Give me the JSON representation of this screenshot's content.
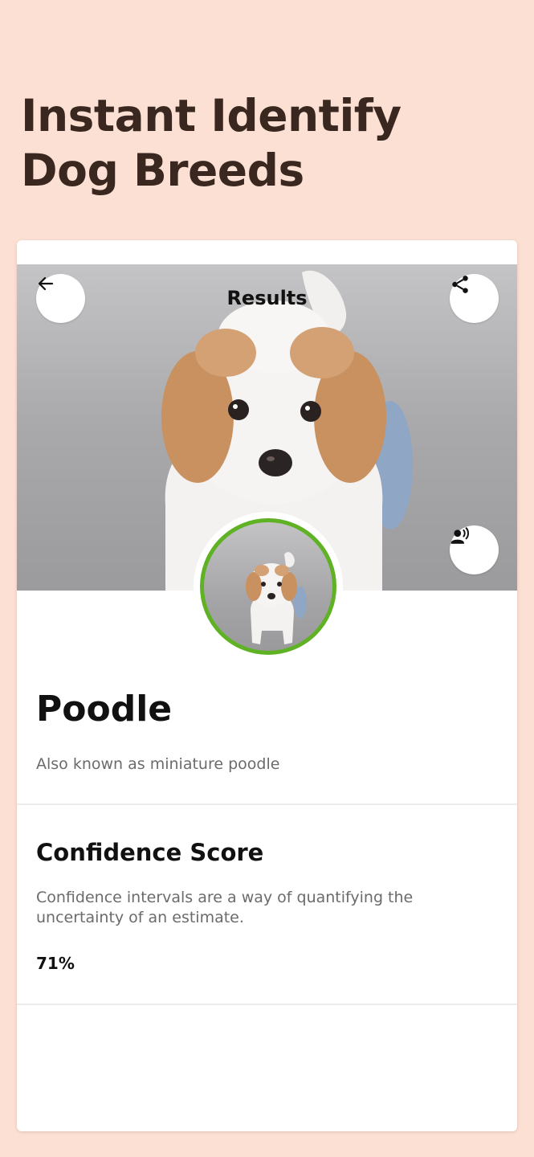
{
  "headline": {
    "line1": "Instant Identify",
    "line2": "Dog Breeds"
  },
  "result_screen": {
    "title": "Results",
    "icons": {
      "back": "arrow-left-icon",
      "share": "share-icon",
      "speak": "speaker-person-icon"
    },
    "breed": {
      "name": "Poodle",
      "aka": "Also known as miniature poodle"
    },
    "confidence": {
      "title": "Confidence Score",
      "description": "Confidence intervals are a way of quantifying the uncertainty of an estimate.",
      "value": "71%"
    }
  },
  "colors": {
    "page_background": "#fbe0d3",
    "card_background": "#ffffff",
    "headline_text": "#3a2820",
    "thumbnail_ring": "#5fb224",
    "muted_text": "#6b6b6b"
  }
}
